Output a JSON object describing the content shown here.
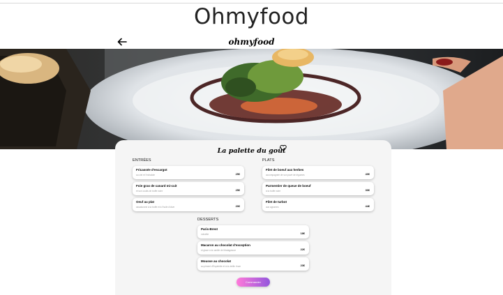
{
  "page": {
    "title": "Ohmyfood"
  },
  "header": {
    "logo": "ohmyfood",
    "back_icon": "arrow-left-icon"
  },
  "hero": {
    "image": "plated fish dish with greens and sauce"
  },
  "restaurant": {
    "name": "La palette du goût",
    "like_icon": "heart-icon"
  },
  "menu": {
    "entrees": {
      "title": "ENTRÉES",
      "items": [
        {
          "name": "Fricassée d'escargot",
          "desc": "au ciel et l'echalote",
          "price": "25€"
        },
        {
          "name": "Foie gras de canard mi-cuit",
          "desc": "et son coulis de truffe noire",
          "price": "25€"
        },
        {
          "name": "Oeuf au plat",
          "desc": "assaisonné à la truffe et à l'huile d'olive",
          "price": "20€"
        }
      ]
    },
    "plats": {
      "title": "PLATS",
      "items": [
        {
          "name": "Filet de boeuf aux herbes",
          "desc": "accompagnée de son pavé de légumes",
          "price": "40€"
        },
        {
          "name": "Parmentier de queue de boeuf",
          "desc": "à la truffe noire",
          "price": "30€"
        },
        {
          "name": "Filet de turbot",
          "desc": "aux agrumes",
          "price": "44€"
        }
      ]
    },
    "desserts": {
      "title": "DESSERTS",
      "items": [
        {
          "name": "Paris-Brest",
          "desc": "noisette",
          "price": "18€"
        },
        {
          "name": "Macaron au chocolat d'exception",
          "desc": "et glace à la vanille de Madagascar",
          "price": "22€"
        },
        {
          "name": "Mousse au chocolat",
          "desc": "au piment d'Espelette et à la vieille rhum",
          "price": "23€"
        }
      ]
    }
  },
  "cta": {
    "label": "Commander"
  },
  "colors": {
    "cta_start": "#ff79da",
    "cta_end": "#9356dc",
    "card_bg": "#f5f5f5"
  }
}
